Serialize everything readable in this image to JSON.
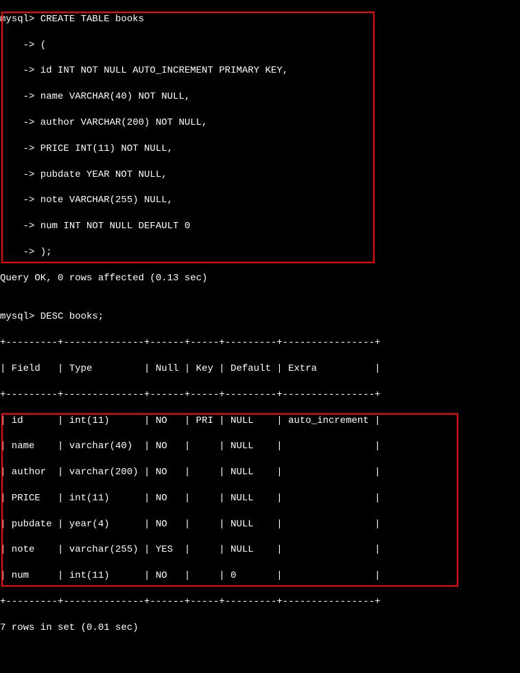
{
  "create_table": {
    "line0": "mysql> CREATE TABLE books",
    "line1": "    -> (",
    "line2": "    -> id INT NOT NULL AUTO_INCREMENT PRIMARY KEY,",
    "line3": "    -> name VARCHAR(40) NOT NULL,",
    "line4": "    -> author VARCHAR(200) NOT NULL,",
    "line5": "    -> PRICE INT(11) NOT NULL,",
    "line6": "    -> pubdate YEAR NOT NULL,",
    "line7": "    -> note VARCHAR(255) NULL,",
    "line8": "    -> num INT NOT NULL DEFAULT 0",
    "line9": "    -> );"
  },
  "query_ok": "Query OK, 0 rows affected (0.13 sec)",
  "blank": "",
  "desc_cmd": "mysql> DESC books;",
  "sep": "+---------+--------------+------+-----+---------+----------------+",
  "header": "| Field   | Type         | Null | Key | Default | Extra          |",
  "rows": {
    "r0": "| id      | int(11)      | NO   | PRI | NULL    | auto_increment |",
    "r1": "| name    | varchar(40)  | NO   |     | NULL    |                |",
    "r2": "| author  | varchar(200) | NO   |     | NULL    |                |",
    "r3": "| PRICE   | int(11)      | NO   |     | NULL    |                |",
    "r4": "| pubdate | year(4)      | NO   |     | NULL    |                |",
    "r5": "| note    | varchar(255) | YES  |     | NULL    |                |",
    "r6": "| num     | int(11)      | NO   |     | 0       |                |"
  },
  "rows_in_set": "7 rows in set (0.01 sec)",
  "chart_data": {
    "type": "table",
    "title": "DESC books",
    "columns": [
      "Field",
      "Type",
      "Null",
      "Key",
      "Default",
      "Extra"
    ],
    "data": [
      {
        "Field": "id",
        "Type": "int(11)",
        "Null": "NO",
        "Key": "PRI",
        "Default": "NULL",
        "Extra": "auto_increment"
      },
      {
        "Field": "name",
        "Type": "varchar(40)",
        "Null": "NO",
        "Key": "",
        "Default": "NULL",
        "Extra": ""
      },
      {
        "Field": "author",
        "Type": "varchar(200)",
        "Null": "NO",
        "Key": "",
        "Default": "NULL",
        "Extra": ""
      },
      {
        "Field": "PRICE",
        "Type": "int(11)",
        "Null": "NO",
        "Key": "",
        "Default": "NULL",
        "Extra": ""
      },
      {
        "Field": "pubdate",
        "Type": "year(4)",
        "Null": "NO",
        "Key": "",
        "Default": "NULL",
        "Extra": ""
      },
      {
        "Field": "note",
        "Type": "varchar(255)",
        "Null": "YES",
        "Key": "",
        "Default": "NULL",
        "Extra": ""
      },
      {
        "Field": "num",
        "Type": "int(11)",
        "Null": "NO",
        "Key": "",
        "Default": "0",
        "Extra": ""
      }
    ]
  }
}
